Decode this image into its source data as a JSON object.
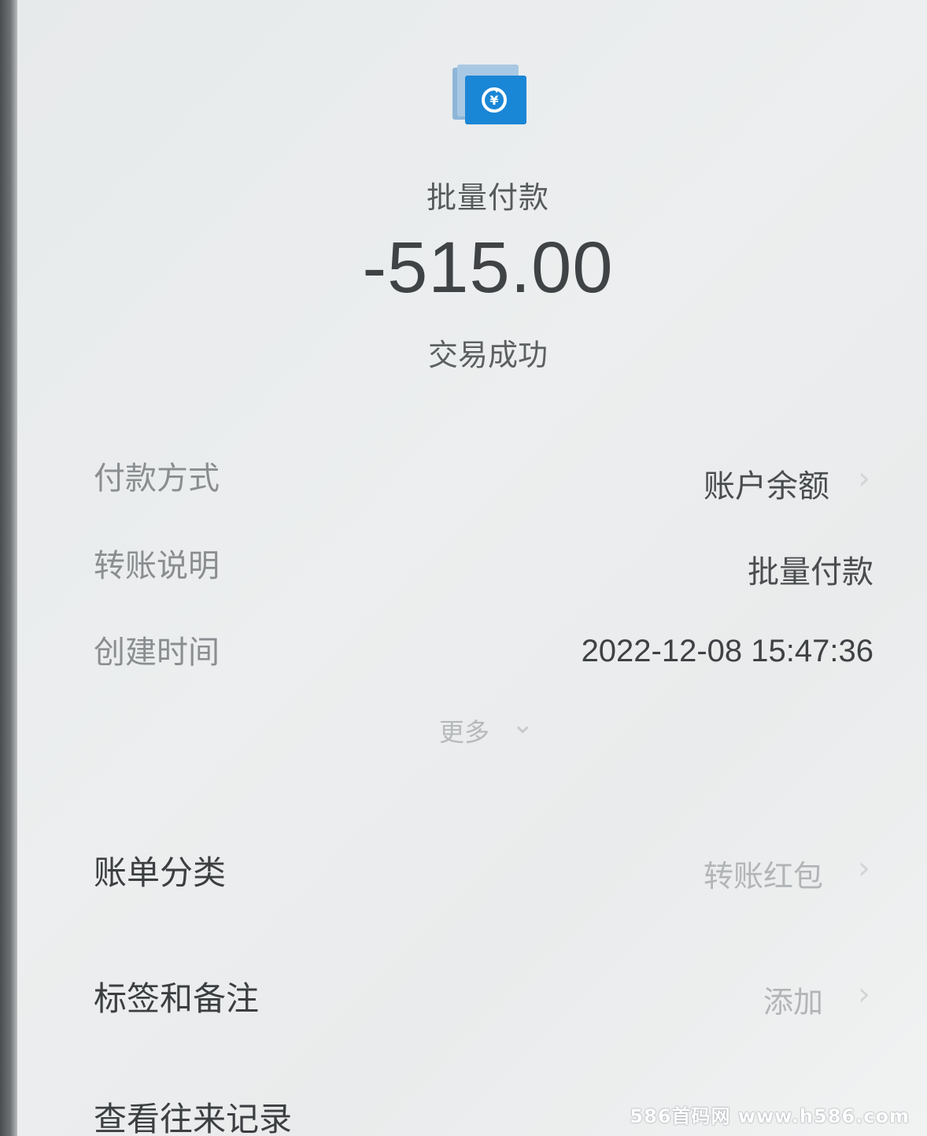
{
  "header": {
    "title": "批量付款",
    "amount": "-515.00",
    "status": "交易成功"
  },
  "details": {
    "payment_method_label": "付款方式",
    "payment_method_value": "账户余额",
    "transfer_note_label": "转账说明",
    "transfer_note_value": "批量付款",
    "created_time_label": "创建时间",
    "created_time_value": "2022-12-08 15:47:36",
    "more_label": "更多"
  },
  "sections": {
    "category_label": "账单分类",
    "category_value": "转账红包",
    "tags_label": "标签和备注",
    "tags_value": "添加",
    "history_label": "查看往来记录"
  },
  "watermark": "586首码网 www.h586.com",
  "colors": {
    "icon_blue": "#1a86d6",
    "icon_back": "#8fb6d8"
  },
  "icons": {
    "app_icon": "batch-payment-icon",
    "chevron_right": "chevron-right-icon",
    "chevron_down": "chevron-down-icon"
  }
}
